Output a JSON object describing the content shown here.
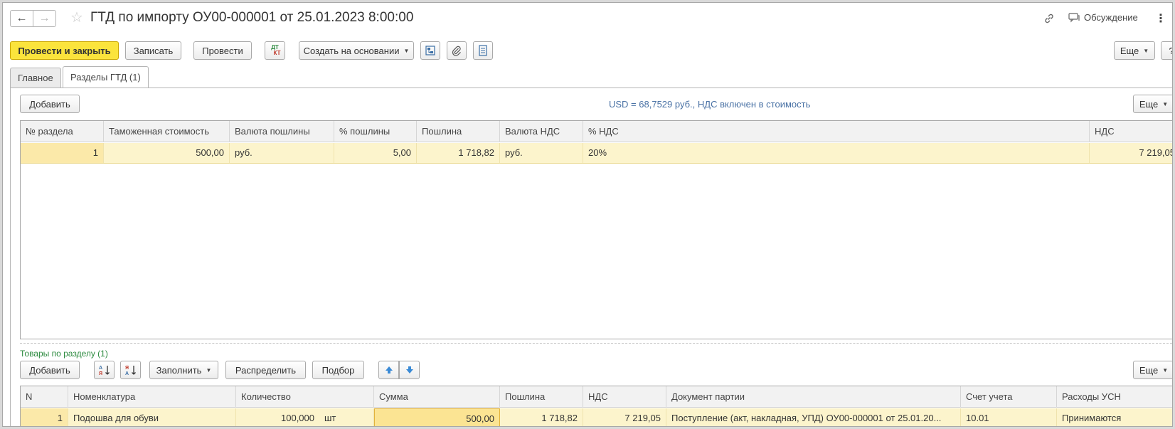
{
  "window": {
    "title": "ГТД по импорту ОУ00-000001 от 25.01.2023 8:00:00",
    "discussion_label": "Обсуждение"
  },
  "toolbar": {
    "post_close": "Провести и закрыть",
    "save": "Записать",
    "post": "Провести",
    "dtkt_top": "ДТ",
    "dtkt_bottom": "КТ",
    "create_based": "Создать на основании",
    "more": "Еще",
    "help": "?"
  },
  "tabs": [
    {
      "label": "Главное"
    },
    {
      "label": "Разделы ГТД (1)"
    }
  ],
  "sections": {
    "add_label": "Добавить",
    "info": "USD = 68,7529 руб., НДС включен в стоимость",
    "more": "Еще",
    "columns": [
      "№ раздела",
      "Таможенная стоимость",
      "Валюта пошлины",
      "% пошлины",
      "Пошлина",
      "Валюта НДС",
      "% НДС",
      "НДС"
    ],
    "rows": [
      [
        "1",
        "500,00",
        "руб.",
        "5,00",
        "1 718,82",
        "руб.",
        "20%",
        "7 219,05"
      ]
    ]
  },
  "goods": {
    "title": "Товары по разделу (1)",
    "add_label": "Добавить",
    "fill_label": "Заполнить",
    "distribute_label": "Распределить",
    "select_label": "Подбор",
    "more": "Еще",
    "columns": [
      "N",
      "Номенклатура",
      "Количество",
      "Сумма",
      "Пошлина",
      "НДС",
      "Документ партии",
      "Счет учета",
      "Расходы УСН"
    ],
    "rows": [
      {
        "n": "1",
        "item": "Подошва для обуви",
        "qty": "100,000",
        "unit": "шт",
        "sum": "500,00",
        "duty": "1 718,82",
        "vat": "7 219,05",
        "doc": "Поступление (акт, накладная, УПД) ОУ00-000001 от 25.01.20...",
        "account": "10.01",
        "usn": "Принимаются"
      }
    ]
  },
  "colors": {
    "primary_button": "#fbe43c",
    "selected_row": "#fcf4cc",
    "info_text": "#4a72a5",
    "section_title": "#2b8a3e"
  }
}
